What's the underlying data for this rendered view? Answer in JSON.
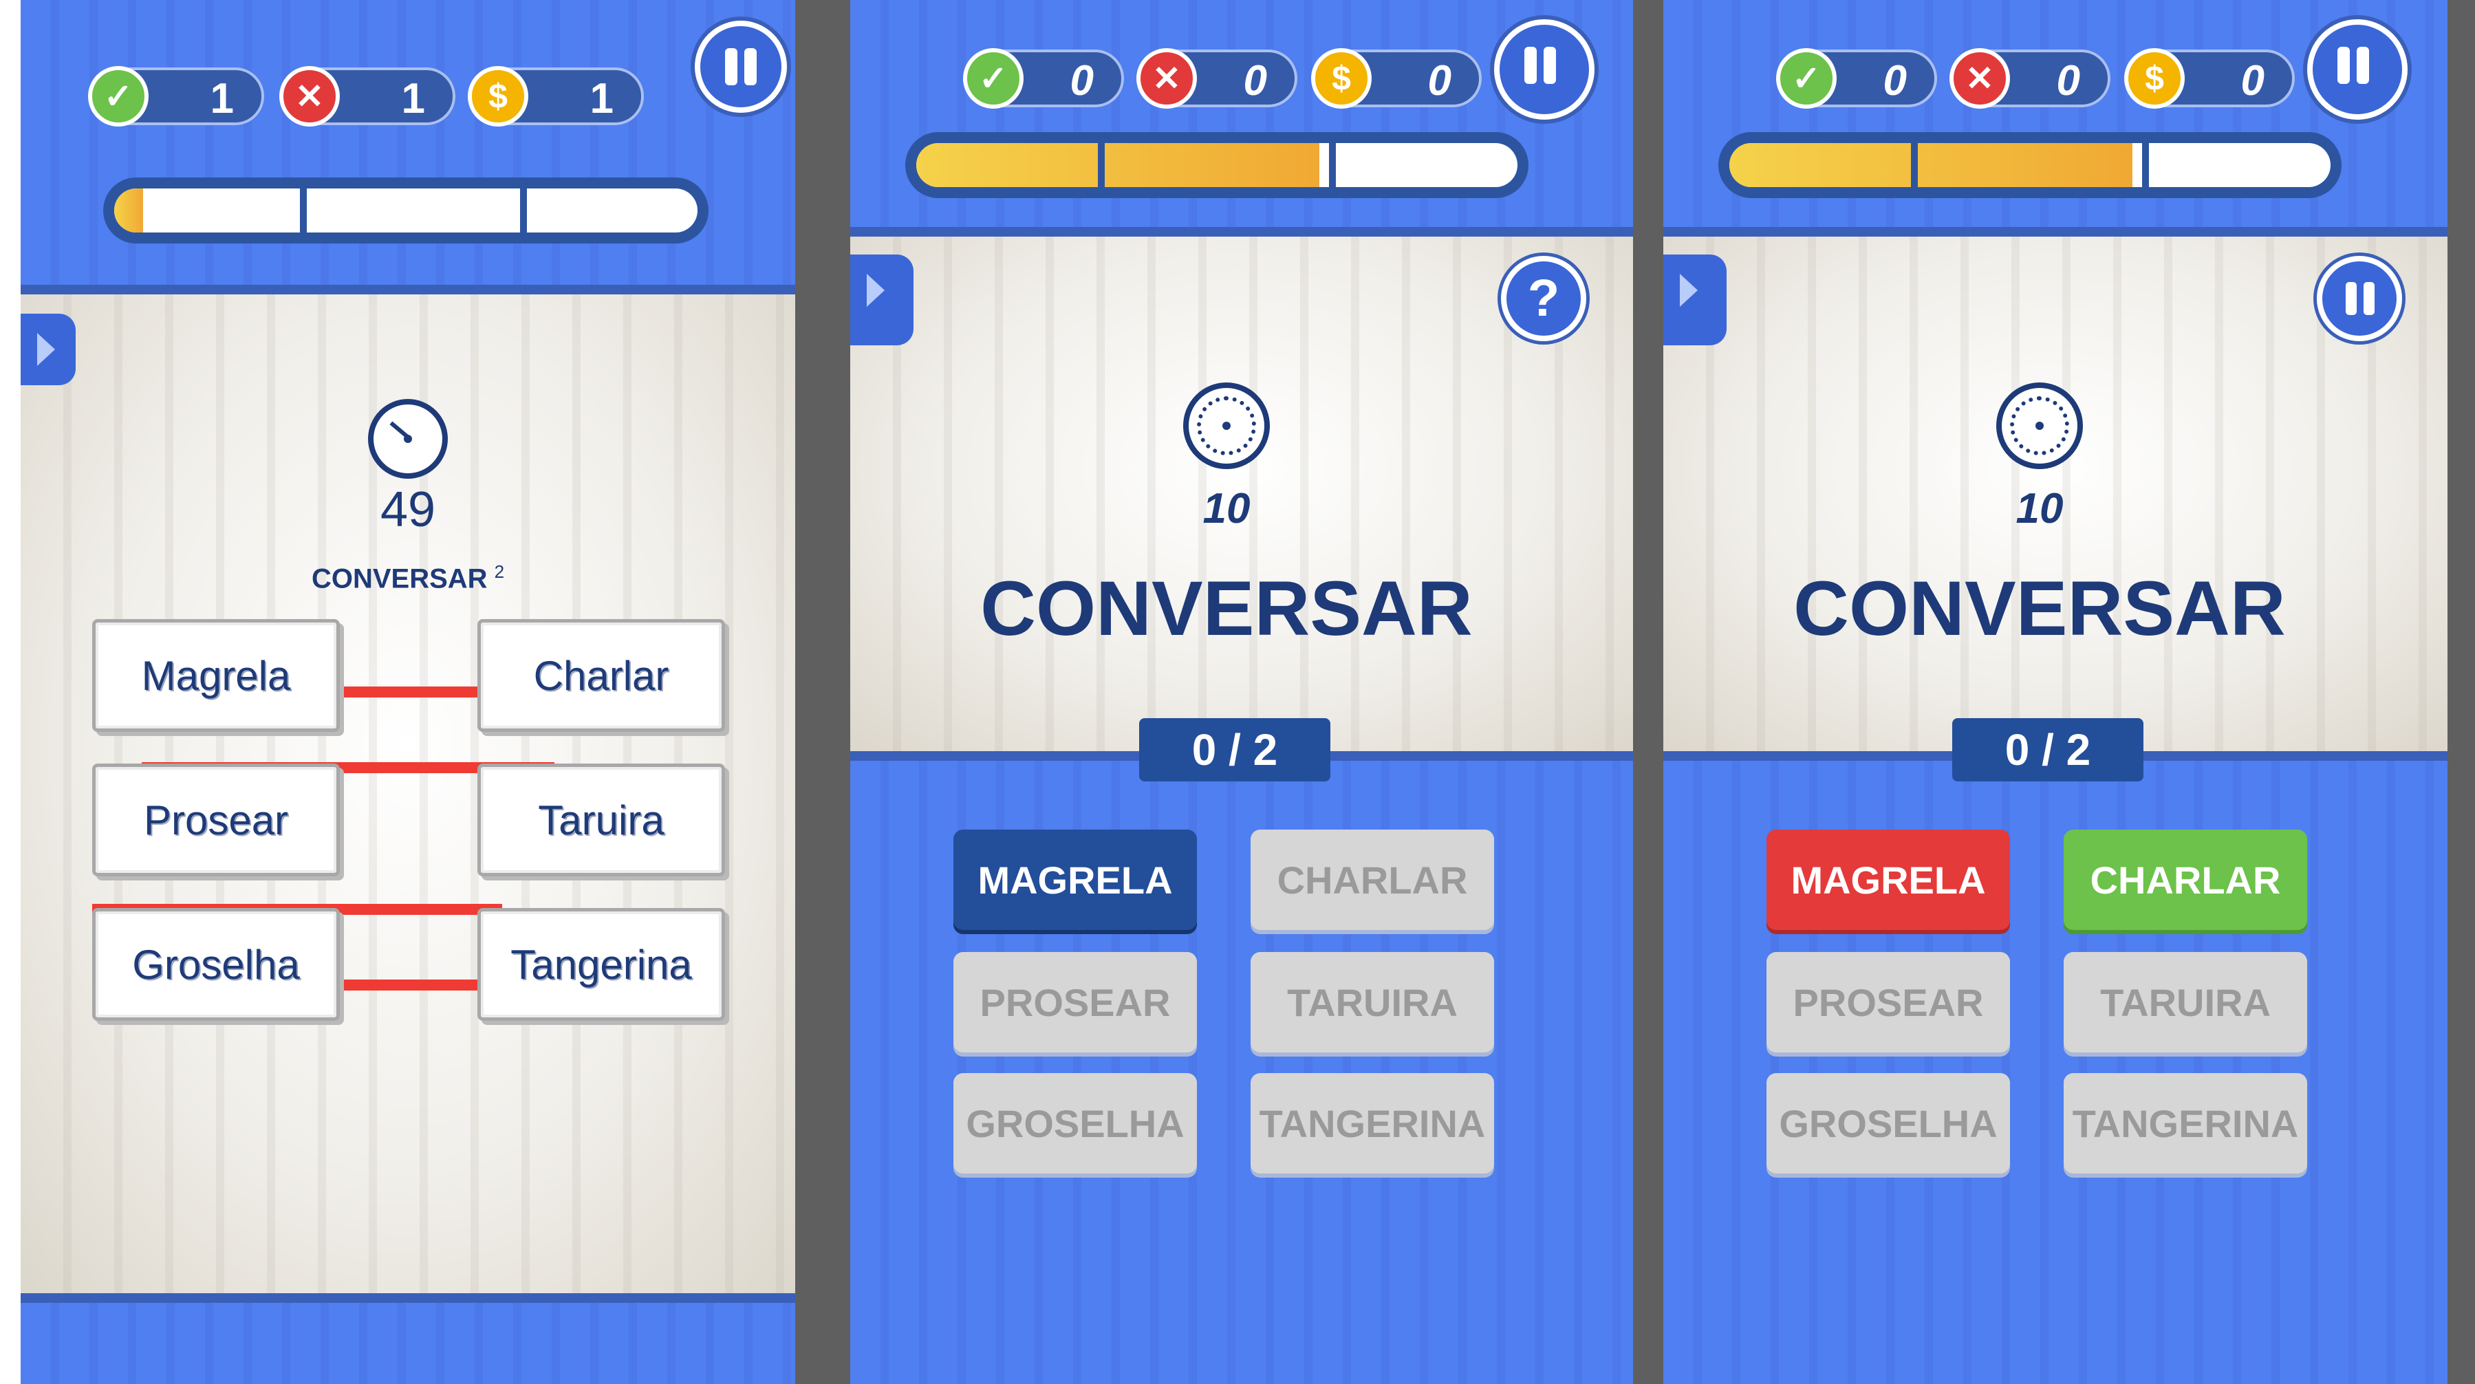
{
  "colors": {
    "game_blue": "#4f7ff0",
    "navy": "#1e3a78",
    "correct_green": "#6cc24a",
    "wrong_red": "#e23a3a",
    "coin_gold": "#f4b400",
    "selected_blue": "#234e9a",
    "link_red": "#ef3b33"
  },
  "screens": [
    {
      "hud": {
        "correct": "1",
        "wrong": "1",
        "coins": "1",
        "progress": 0.05
      },
      "timer": "49",
      "word": "CONVERSAR",
      "superscript": "2",
      "left_words": [
        "Magrela",
        "Prosear",
        "Groselha"
      ],
      "right_words": [
        "Charlar",
        "Taruira",
        "Tangerina"
      ]
    },
    {
      "hud": {
        "correct": "0",
        "wrong": "0",
        "coins": "0",
        "progress": 0.67
      },
      "timer": "10",
      "word": "CONVERSAR",
      "score": "0 / 2",
      "help_symbol": "?",
      "options": [
        "MAGRELA",
        "CHARLAR",
        "PROSEAR",
        "TARUIRA",
        "GROSELHA",
        "TANGERINA"
      ],
      "option_states": [
        "selected",
        "idle",
        "idle",
        "idle",
        "idle",
        "idle"
      ]
    },
    {
      "hud": {
        "correct": "0",
        "wrong": "0",
        "coins": "0",
        "progress": 0.67
      },
      "timer": "10",
      "word": "CONVERSAR",
      "score": "0 / 2",
      "options": [
        "MAGRELA",
        "CHARLAR",
        "PROSEAR",
        "TARUIRA",
        "GROSELHA",
        "TANGERINA"
      ],
      "option_states": [
        "wrong",
        "right",
        "idle",
        "idle",
        "idle",
        "idle"
      ]
    }
  ],
  "icons": {
    "correct": "✓",
    "wrong": "✕",
    "coin": "$"
  }
}
